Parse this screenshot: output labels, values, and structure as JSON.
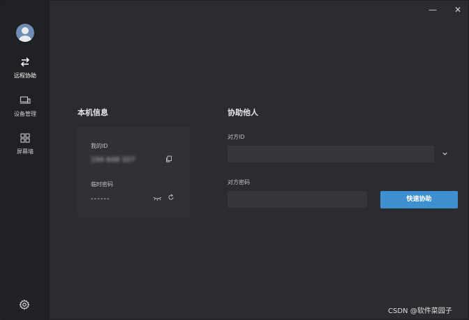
{
  "window": {
    "minimize": "—",
    "close": "✕"
  },
  "sidebar": {
    "items": [
      {
        "label": "远程协助",
        "icon": "swap-arrows-icon",
        "active": true
      },
      {
        "label": "设备管理",
        "icon": "devices-icon",
        "active": false
      },
      {
        "label": "屏幕墙",
        "icon": "grid-icon",
        "active": false
      }
    ],
    "settings_icon": "gear-icon"
  },
  "local_info": {
    "title": "本机信息",
    "my_id_label": "我的ID",
    "my_id_value": "194 648 327",
    "temp_password_label": "临时密码",
    "temp_password_value": "------"
  },
  "assist_others": {
    "title": "协助他人",
    "peer_id_label": "对方ID",
    "peer_id_value": "",
    "peer_password_label": "对方密码",
    "peer_password_value": "",
    "submit_label": "快速协助"
  },
  "watermark": "CSDN @软件菜园子",
  "colors": {
    "accent": "#3d8fcf",
    "sidebar": "#202124",
    "background": "#2b2c2f"
  }
}
